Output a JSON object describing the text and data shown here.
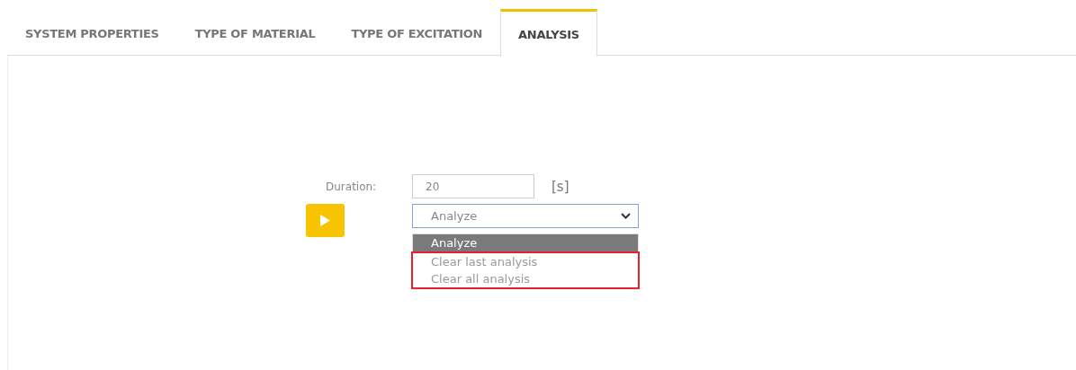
{
  "tabs": [
    {
      "label": "SYSTEM PROPERTIES",
      "selected": false
    },
    {
      "label": "TYPE OF MATERIAL",
      "selected": false
    },
    {
      "label": "TYPE OF EXCITATION",
      "selected": false
    },
    {
      "label": "ANALYSIS",
      "selected": true
    }
  ],
  "duration": {
    "label": "Duration:",
    "value": "20",
    "unit": "[s]"
  },
  "select": {
    "value": "Analyze",
    "expanded": true
  },
  "options": [
    {
      "label": "Analyze",
      "selected": true,
      "highlighted": false
    },
    {
      "label": "Clear last analysis",
      "selected": false,
      "highlighted": true
    },
    {
      "label": "Clear all analysis",
      "selected": false,
      "highlighted": true
    }
  ]
}
